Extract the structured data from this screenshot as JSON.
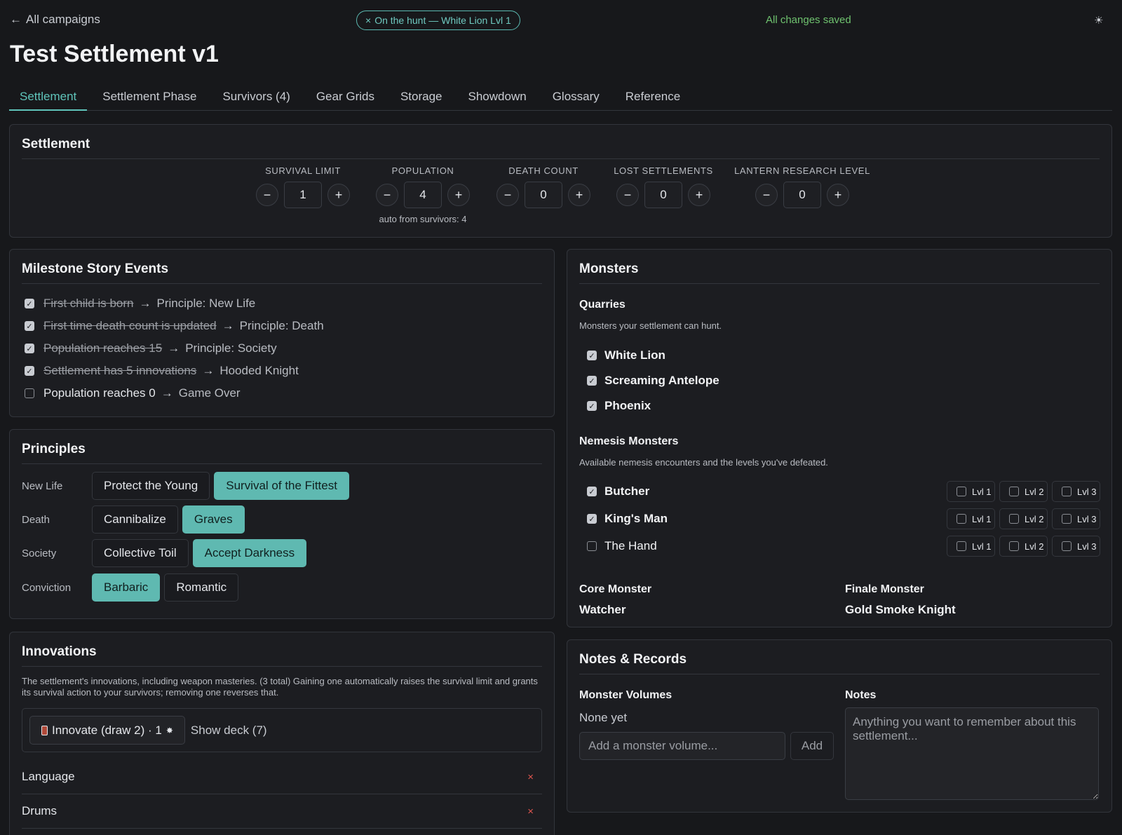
{
  "header": {
    "back_label": "All campaigns",
    "back_icon": "arrow-left-icon",
    "hunt_badge": "On the hunt — White Lion Lvl 1",
    "save_status": "All changes saved",
    "theme_icon": "sun-icon",
    "title": "Test Settlement v1"
  },
  "tabs": [
    {
      "label": "Settlement",
      "active": true
    },
    {
      "label": "Settlement Phase"
    },
    {
      "label": "Survivors (4)"
    },
    {
      "label": "Gear Grids"
    },
    {
      "label": "Storage"
    },
    {
      "label": "Showdown"
    },
    {
      "label": "Glossary"
    },
    {
      "label": "Reference"
    }
  ],
  "settlement": {
    "title": "Settlement",
    "stats": [
      {
        "label": "SURVIVAL LIMIT",
        "value": "1"
      },
      {
        "label": "POPULATION",
        "value": "4",
        "note": "auto from survivors: 4"
      },
      {
        "label": "DEATH COUNT",
        "value": "0"
      },
      {
        "label": "LOST SETTLEMENTS",
        "value": "0"
      },
      {
        "label": "LANTERN RESEARCH LEVEL",
        "value": "0"
      }
    ],
    "minus": "−",
    "plus": "+"
  },
  "milestones": {
    "title": "Milestone Story Events",
    "arrow": "→",
    "items": [
      {
        "event": "First child is born",
        "result": "Principle: New Life",
        "checked": true
      },
      {
        "event": "First time death count is updated",
        "result": "Principle: Death",
        "checked": true
      },
      {
        "event": "Population reaches 15",
        "result": "Principle: Society",
        "checked": true
      },
      {
        "event": "Settlement has 5 innovations",
        "result": "Hooded Knight",
        "checked": true
      },
      {
        "event": "Population reaches 0",
        "result": "Game Over",
        "checked": false
      }
    ]
  },
  "principles": {
    "title": "Principles",
    "rows": [
      {
        "label": "New Life",
        "options": [
          "Protect the Young",
          "Survival of the Fittest"
        ],
        "selected": 1
      },
      {
        "label": "Death",
        "options": [
          "Cannibalize",
          "Graves"
        ],
        "selected": 1
      },
      {
        "label": "Society",
        "options": [
          "Collective Toil",
          "Accept Darkness"
        ],
        "selected": 1
      },
      {
        "label": "Conviction",
        "options": [
          "Barbaric",
          "Romantic"
        ],
        "selected": 0
      }
    ]
  },
  "innovations": {
    "title": "Innovations",
    "description": "The settlement's innovations, including weapon masteries. (3 total) Gaining one automatically raises the survival limit and grants its survival action to your survivors; removing one reverses that.",
    "innovate_label": "Innovate (draw 2) · 1",
    "show_deck_label": "Show deck (7)",
    "items": [
      "Language",
      "Drums"
    ],
    "remove_glyph": "×"
  },
  "monsters": {
    "title": "Monsters",
    "quarries_title": "Quarries",
    "quarries_sub": "Monsters your settlement can hunt.",
    "quarries": [
      {
        "name": "White Lion",
        "checked": true
      },
      {
        "name": "Screaming Antelope",
        "checked": true
      },
      {
        "name": "Phoenix",
        "checked": true
      }
    ],
    "nemesis_title": "Nemesis Monsters",
    "nemesis_sub": "Available nemesis encounters and the levels you've defeated.",
    "nemesis": [
      {
        "name": "Butcher",
        "checked": true
      },
      {
        "name": "King's Man",
        "checked": true
      },
      {
        "name": "The Hand",
        "checked": false
      }
    ],
    "levels": [
      "Lvl 1",
      "Lvl 2",
      "Lvl 3"
    ],
    "core_label": "Core Monster",
    "core_value": "Watcher",
    "finale_label": "Finale Monster",
    "finale_value": "Gold Smoke Knight"
  },
  "notes": {
    "title": "Notes & Records",
    "volumes_label": "Monster Volumes",
    "volumes_empty": "None yet",
    "volume_placeholder": "Add a monster volume...",
    "add_label": "Add",
    "notes_label": "Notes",
    "notes_placeholder": "Anything you want to remember about this settlement..."
  },
  "colors": {
    "accent": "#5fb9b1",
    "saved": "#6fc26f",
    "danger": "#e0564f",
    "background": "#17181b"
  }
}
